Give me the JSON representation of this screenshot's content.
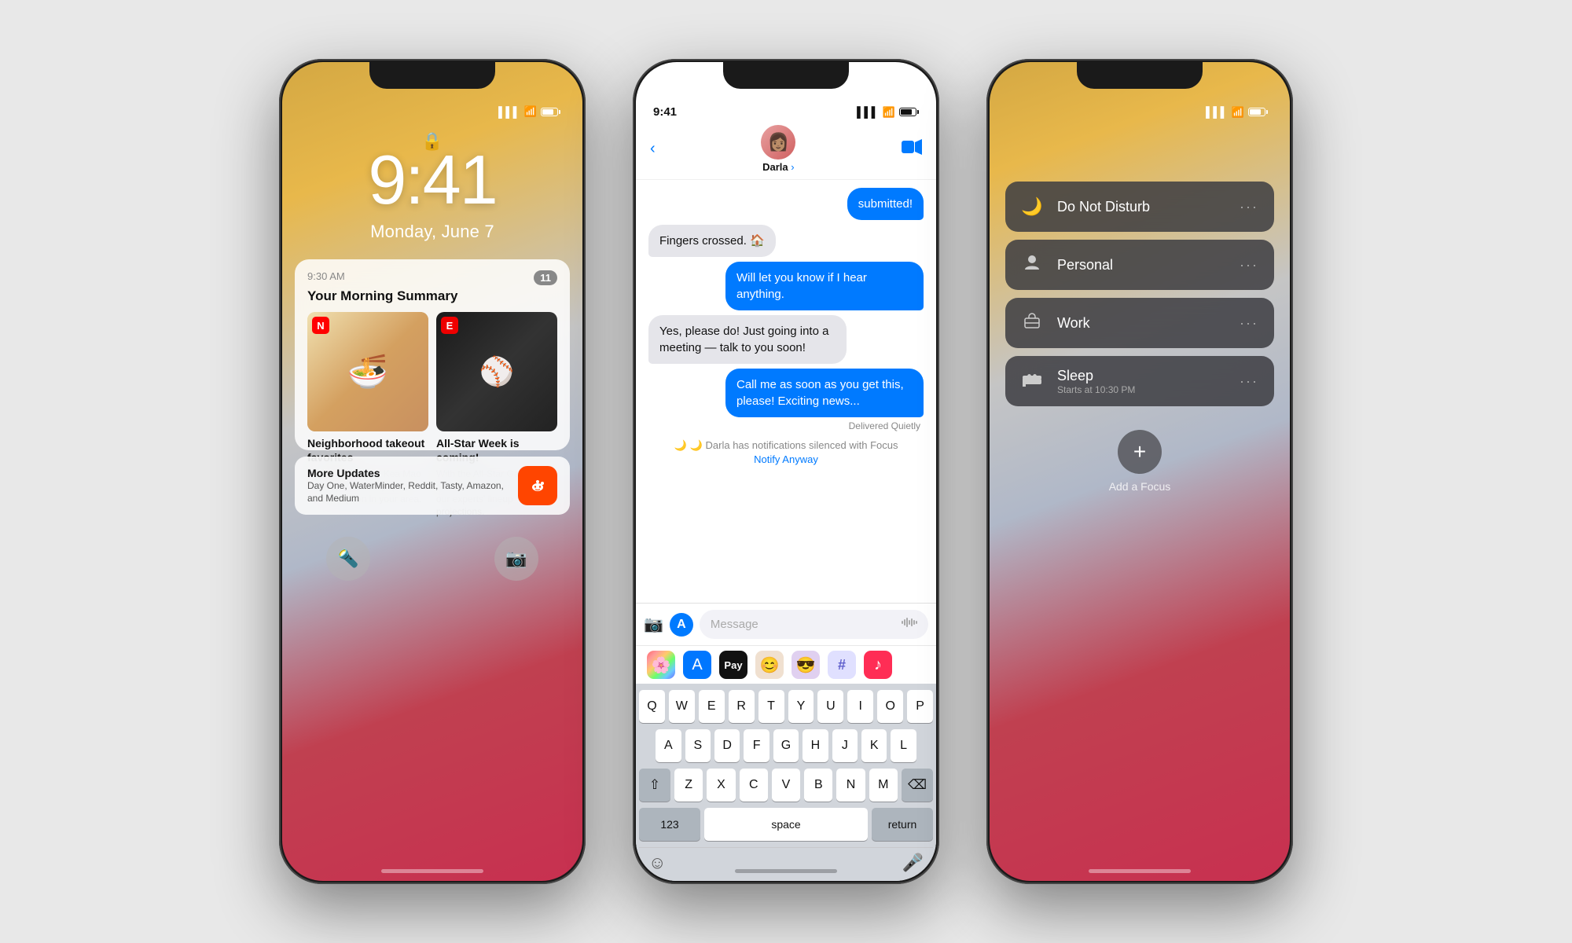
{
  "background_color": "#e8e8e8",
  "phone1": {
    "time": "9:41",
    "date": "Monday, June 7",
    "status_left": "",
    "notification": {
      "time": "9:30 AM",
      "badge": "11",
      "title": "Your Morning Summary",
      "article1": {
        "title": "Neighborhood takeout favorites",
        "body": "Need inspiration? Kea Mao from Up Thai is a popular takeout option in your area."
      },
      "article2": {
        "title": "All-Star Week is coming!",
        "body": "With the All-Star Game just around the corner, check out our experts' lineup projections."
      }
    },
    "more_updates": {
      "title": "More Updates",
      "body": "Day One, WaterMinder, Reddit, Tasty, Amazon, and Medium"
    },
    "flashlight_label": "🔦",
    "camera_label": "📷"
  },
  "phone2": {
    "status_time": "9:41",
    "contact_name": "Darla",
    "contact_name_arrow": "Darla >",
    "messages": [
      {
        "text": "submitted!",
        "type": "sent"
      },
      {
        "text": "Fingers crossed. 🏠",
        "type": "received"
      },
      {
        "text": "Will let you know if I hear anything.",
        "type": "sent"
      },
      {
        "text": "Yes, please do! Just going into a meeting — talk to you soon!",
        "type": "received"
      },
      {
        "text": "Call me as soon as you get this, please! Exciting news...",
        "type": "sent"
      }
    ],
    "delivered_quietly": "Delivered Quietly",
    "focus_notice": "🌙 Darla has notifications silenced with Focus",
    "notify_anyway": "Notify Anyway",
    "input_placeholder": "Message",
    "keyboard_rows": [
      [
        "Q",
        "W",
        "E",
        "R",
        "T",
        "Y",
        "U",
        "I",
        "O",
        "P"
      ],
      [
        "A",
        "S",
        "D",
        "F",
        "G",
        "H",
        "J",
        "K",
        "L"
      ],
      [
        "Z",
        "X",
        "C",
        "V",
        "B",
        "N",
        "M"
      ],
      [
        "123",
        "space",
        "return"
      ]
    ],
    "app_strip": [
      "📷",
      "🅐",
      "💳",
      "😀",
      "😎",
      "🔍",
      "🎵"
    ]
  },
  "phone3": {
    "focus_items": [
      {
        "icon": "🌙",
        "label": "Do Not Disturb",
        "sub": ""
      },
      {
        "icon": "👤",
        "label": "Personal",
        "sub": ""
      },
      {
        "icon": "🪪",
        "label": "Work",
        "sub": ""
      },
      {
        "icon": "🛏",
        "label": "Sleep",
        "sub": "Starts at 10:30 PM"
      }
    ],
    "add_focus_label": "Add a Focus",
    "add_focus_icon": "+"
  }
}
